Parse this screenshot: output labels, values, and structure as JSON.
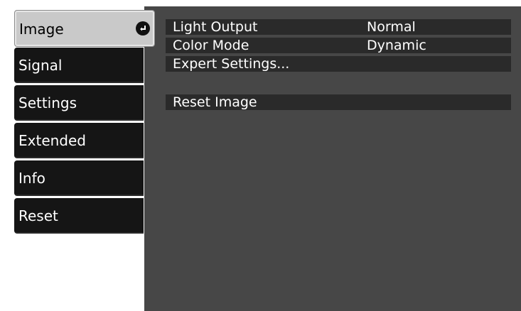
{
  "sidebar": {
    "tabs": [
      {
        "label": "Image",
        "selected": true
      },
      {
        "label": "Signal",
        "selected": false
      },
      {
        "label": "Settings",
        "selected": false
      },
      {
        "label": "Extended",
        "selected": false
      },
      {
        "label": "Info",
        "selected": false
      },
      {
        "label": "Reset",
        "selected": false
      }
    ],
    "selected_icon": "enter-icon"
  },
  "menu": {
    "rows": [
      {
        "label": "Light Output",
        "value": "Normal"
      },
      {
        "label": "Color Mode",
        "value": "Dynamic"
      },
      {
        "label": "Expert Settings..."
      },
      {
        "label": "Reset Image"
      }
    ]
  },
  "colors": {
    "panel_bg": "#474747",
    "tab_bg": "#151515",
    "tab_selected_bg": "#c9c9c9",
    "row_bg": "#2a2a2a"
  }
}
